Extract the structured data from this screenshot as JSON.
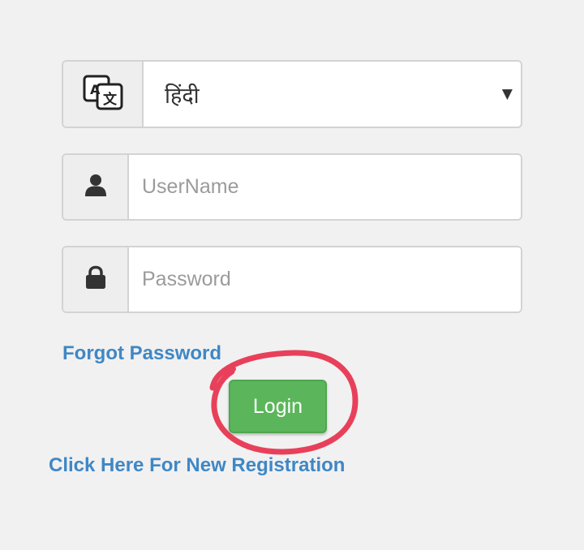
{
  "language": {
    "icon": "translate-icon",
    "selected": "हिंदी",
    "caret": "▼"
  },
  "username": {
    "icon": "user-icon",
    "placeholder": "UserName",
    "value": ""
  },
  "password": {
    "icon": "lock-icon",
    "placeholder": "Password",
    "value": ""
  },
  "links": {
    "forgot_password": "Forgot Password",
    "new_registration": "Click Here For New Registration"
  },
  "login_button": {
    "label": "Login",
    "color": "#5bb65b"
  },
  "annotation": {
    "shape": "hand-drawn-circle",
    "color": "#e8405a",
    "target": "login_button"
  },
  "colors": {
    "link": "#3f87c5",
    "background": "#f1f1f1"
  }
}
